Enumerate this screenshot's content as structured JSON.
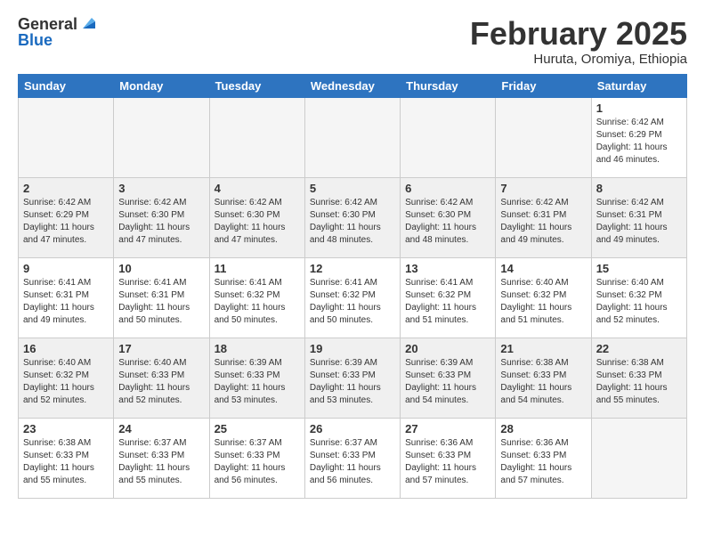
{
  "header": {
    "logo_general": "General",
    "logo_blue": "Blue",
    "month_title": "February 2025",
    "location": "Huruta, Oromiya, Ethiopia"
  },
  "weekdays": [
    "Sunday",
    "Monday",
    "Tuesday",
    "Wednesday",
    "Thursday",
    "Friday",
    "Saturday"
  ],
  "weeks": [
    [
      {
        "day": "",
        "info": ""
      },
      {
        "day": "",
        "info": ""
      },
      {
        "day": "",
        "info": ""
      },
      {
        "day": "",
        "info": ""
      },
      {
        "day": "",
        "info": ""
      },
      {
        "day": "",
        "info": ""
      },
      {
        "day": "1",
        "info": "Sunrise: 6:42 AM\nSunset: 6:29 PM\nDaylight: 11 hours\nand 46 minutes."
      }
    ],
    [
      {
        "day": "2",
        "info": "Sunrise: 6:42 AM\nSunset: 6:29 PM\nDaylight: 11 hours\nand 47 minutes."
      },
      {
        "day": "3",
        "info": "Sunrise: 6:42 AM\nSunset: 6:30 PM\nDaylight: 11 hours\nand 47 minutes."
      },
      {
        "day": "4",
        "info": "Sunrise: 6:42 AM\nSunset: 6:30 PM\nDaylight: 11 hours\nand 47 minutes."
      },
      {
        "day": "5",
        "info": "Sunrise: 6:42 AM\nSunset: 6:30 PM\nDaylight: 11 hours\nand 48 minutes."
      },
      {
        "day": "6",
        "info": "Sunrise: 6:42 AM\nSunset: 6:30 PM\nDaylight: 11 hours\nand 48 minutes."
      },
      {
        "day": "7",
        "info": "Sunrise: 6:42 AM\nSunset: 6:31 PM\nDaylight: 11 hours\nand 49 minutes."
      },
      {
        "day": "8",
        "info": "Sunrise: 6:42 AM\nSunset: 6:31 PM\nDaylight: 11 hours\nand 49 minutes."
      }
    ],
    [
      {
        "day": "9",
        "info": "Sunrise: 6:41 AM\nSunset: 6:31 PM\nDaylight: 11 hours\nand 49 minutes."
      },
      {
        "day": "10",
        "info": "Sunrise: 6:41 AM\nSunset: 6:31 PM\nDaylight: 11 hours\nand 50 minutes."
      },
      {
        "day": "11",
        "info": "Sunrise: 6:41 AM\nSunset: 6:32 PM\nDaylight: 11 hours\nand 50 minutes."
      },
      {
        "day": "12",
        "info": "Sunrise: 6:41 AM\nSunset: 6:32 PM\nDaylight: 11 hours\nand 50 minutes."
      },
      {
        "day": "13",
        "info": "Sunrise: 6:41 AM\nSunset: 6:32 PM\nDaylight: 11 hours\nand 51 minutes."
      },
      {
        "day": "14",
        "info": "Sunrise: 6:40 AM\nSunset: 6:32 PM\nDaylight: 11 hours\nand 51 minutes."
      },
      {
        "day": "15",
        "info": "Sunrise: 6:40 AM\nSunset: 6:32 PM\nDaylight: 11 hours\nand 52 minutes."
      }
    ],
    [
      {
        "day": "16",
        "info": "Sunrise: 6:40 AM\nSunset: 6:32 PM\nDaylight: 11 hours\nand 52 minutes."
      },
      {
        "day": "17",
        "info": "Sunrise: 6:40 AM\nSunset: 6:33 PM\nDaylight: 11 hours\nand 52 minutes."
      },
      {
        "day": "18",
        "info": "Sunrise: 6:39 AM\nSunset: 6:33 PM\nDaylight: 11 hours\nand 53 minutes."
      },
      {
        "day": "19",
        "info": "Sunrise: 6:39 AM\nSunset: 6:33 PM\nDaylight: 11 hours\nand 53 minutes."
      },
      {
        "day": "20",
        "info": "Sunrise: 6:39 AM\nSunset: 6:33 PM\nDaylight: 11 hours\nand 54 minutes."
      },
      {
        "day": "21",
        "info": "Sunrise: 6:38 AM\nSunset: 6:33 PM\nDaylight: 11 hours\nand 54 minutes."
      },
      {
        "day": "22",
        "info": "Sunrise: 6:38 AM\nSunset: 6:33 PM\nDaylight: 11 hours\nand 55 minutes."
      }
    ],
    [
      {
        "day": "23",
        "info": "Sunrise: 6:38 AM\nSunset: 6:33 PM\nDaylight: 11 hours\nand 55 minutes."
      },
      {
        "day": "24",
        "info": "Sunrise: 6:37 AM\nSunset: 6:33 PM\nDaylight: 11 hours\nand 55 minutes."
      },
      {
        "day": "25",
        "info": "Sunrise: 6:37 AM\nSunset: 6:33 PM\nDaylight: 11 hours\nand 56 minutes."
      },
      {
        "day": "26",
        "info": "Sunrise: 6:37 AM\nSunset: 6:33 PM\nDaylight: 11 hours\nand 56 minutes."
      },
      {
        "day": "27",
        "info": "Sunrise: 6:36 AM\nSunset: 6:33 PM\nDaylight: 11 hours\nand 57 minutes."
      },
      {
        "day": "28",
        "info": "Sunrise: 6:36 AM\nSunset: 6:33 PM\nDaylight: 11 hours\nand 57 minutes."
      },
      {
        "day": "",
        "info": ""
      }
    ]
  ]
}
